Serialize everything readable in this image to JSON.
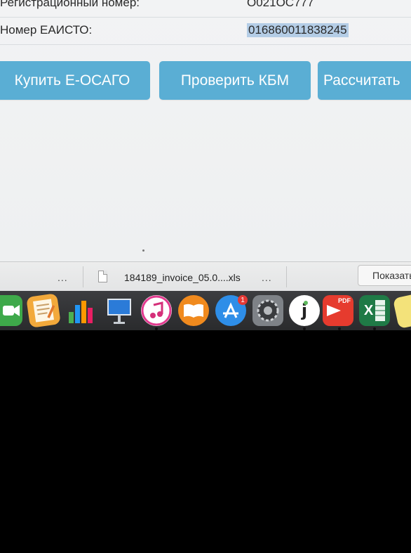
{
  "form": {
    "reg_number_label": "Регистрационный номер:",
    "reg_number_value": "О021ОС777",
    "eaisto_label": "Номер ЕАИСТО:",
    "eaisto_value": "016860011838245"
  },
  "buttons": {
    "buy_eosago": "Купить Е-ОСАГО",
    "check_kbm": "Проверить КБМ",
    "calculate": "Рассчитать"
  },
  "downloads": {
    "more_label": "...",
    "file_name": "184189_invoice_05.0....xls",
    "file_menu": "...",
    "show_all": "Показать все"
  },
  "dock": {
    "app_store_badge": "1",
    "pdf_label": "PDF",
    "excel_label": "X",
    "icons": [
      "facetime-icon",
      "pages-icon",
      "numbers-icon",
      "keynote-icon",
      "itunes-icon",
      "ibooks-icon",
      "app-store-icon",
      "system-preferences-icon",
      "jdownloader-icon",
      "pdf-expert-icon",
      "excel-icon",
      "stickies-icon"
    ]
  },
  "colors": {
    "button_bg": "#5aaed4",
    "selection": "#b4cde6",
    "page_bg": "#f2f3f4"
  }
}
